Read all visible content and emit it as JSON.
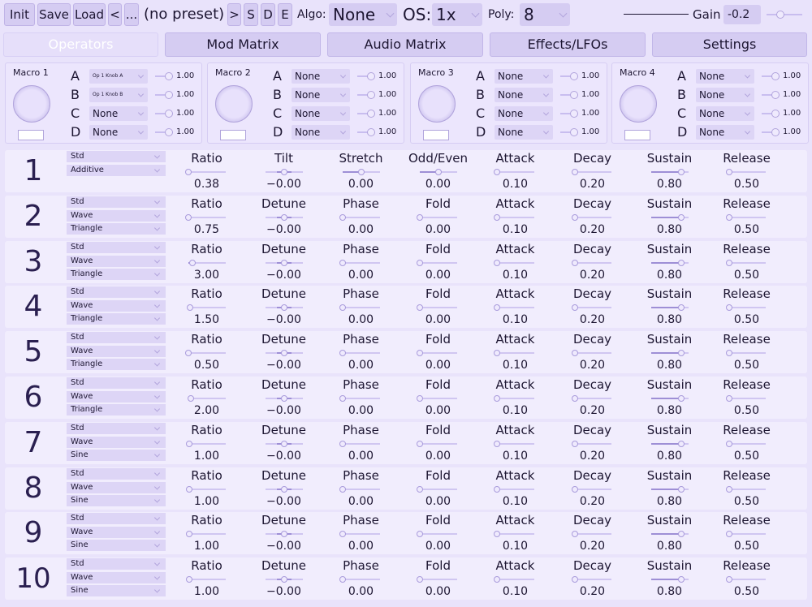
{
  "toolbar": {
    "init": "Init",
    "save": "Save",
    "load": "Load",
    "prev": "<",
    "browse": "...",
    "preset": "(no preset)",
    "next": ">",
    "s": "S",
    "d": "D",
    "e": "E",
    "algo_label": "Algo:",
    "algo_value": "None",
    "os_label": "OS:",
    "os_value": "1x",
    "poly_label": "Poly:",
    "poly_value": "8",
    "gain_label": "Gain",
    "gain_value": "-0.2"
  },
  "tabs": [
    {
      "label": "Operators",
      "active": true
    },
    {
      "label": "Mod Matrix"
    },
    {
      "label": "Audio Matrix"
    },
    {
      "label": "Effects/LFOs"
    },
    {
      "label": "Settings"
    }
  ],
  "macros": [
    {
      "title": "Macro 1",
      "rows": [
        {
          "letter": "A",
          "target": "Op 1 Knob A",
          "value": "1.00"
        },
        {
          "letter": "B",
          "target": "Op 1 Knob B",
          "value": "1.00"
        },
        {
          "letter": "C",
          "target": "None",
          "value": "1.00"
        },
        {
          "letter": "D",
          "target": "None",
          "value": "1.00"
        }
      ]
    },
    {
      "title": "Macro 2",
      "rows": [
        {
          "letter": "A",
          "target": "None",
          "value": "1.00"
        },
        {
          "letter": "B",
          "target": "None",
          "value": "1.00"
        },
        {
          "letter": "C",
          "target": "None",
          "value": "1.00"
        },
        {
          "letter": "D",
          "target": "None",
          "value": "1.00"
        }
      ]
    },
    {
      "title": "Macro 3",
      "rows": [
        {
          "letter": "A",
          "target": "None",
          "value": "1.00"
        },
        {
          "letter": "B",
          "target": "None",
          "value": "1.00"
        },
        {
          "letter": "C",
          "target": "None",
          "value": "1.00"
        },
        {
          "letter": "D",
          "target": "None",
          "value": "1.00"
        }
      ]
    },
    {
      "title": "Macro 4",
      "rows": [
        {
          "letter": "A",
          "target": "None",
          "value": "1.00"
        },
        {
          "letter": "B",
          "target": "None",
          "value": "1.00"
        },
        {
          "letter": "C",
          "target": "None",
          "value": "1.00"
        },
        {
          "letter": "D",
          "target": "None",
          "value": "1.00"
        }
      ]
    }
  ],
  "operators": [
    {
      "num": "1",
      "combos": [
        "Std",
        "Additive"
      ],
      "params": [
        {
          "label": "Ratio",
          "value": "0.38",
          "level": 0.0
        },
        {
          "label": "Tilt",
          "value": "−0.00",
          "level": 0.5
        },
        {
          "label": "Stretch",
          "value": "0.00",
          "level": 0.5
        },
        {
          "label": "Odd/Even",
          "value": "0.00",
          "level": 0.5
        },
        {
          "label": "Attack",
          "value": "0.10",
          "level": 0.0
        },
        {
          "label": "Decay",
          "value": "0.20",
          "level": 0.02
        },
        {
          "label": "Sustain",
          "value": "0.80",
          "level": 0.8
        },
        {
          "label": "Release",
          "value": "0.50",
          "level": 0.02
        }
      ]
    },
    {
      "num": "2",
      "combos": [
        "Std",
        "Wave",
        "Triangle"
      ],
      "params": [
        {
          "label": "Ratio",
          "value": "0.75",
          "level": 0.0
        },
        {
          "label": "Detune",
          "value": "−0.00",
          "level": 0.5
        },
        {
          "label": "Phase",
          "value": "0.00",
          "level": 0.0
        },
        {
          "label": "Fold",
          "value": "0.00",
          "level": 0.0
        },
        {
          "label": "Attack",
          "value": "0.10",
          "level": 0.0
        },
        {
          "label": "Decay",
          "value": "0.20",
          "level": 0.02
        },
        {
          "label": "Sustain",
          "value": "0.80",
          "level": 0.8
        },
        {
          "label": "Release",
          "value": "0.50",
          "level": 0.02
        }
      ]
    },
    {
      "num": "3",
      "combos": [
        "Std",
        "Wave",
        "Triangle"
      ],
      "params": [
        {
          "label": "Ratio",
          "value": "3.00",
          "level": 0.1
        },
        {
          "label": "Detune",
          "value": "−0.00",
          "level": 0.5
        },
        {
          "label": "Phase",
          "value": "0.00",
          "level": 0.0
        },
        {
          "label": "Fold",
          "value": "0.00",
          "level": 0.0
        },
        {
          "label": "Attack",
          "value": "0.10",
          "level": 0.0
        },
        {
          "label": "Decay",
          "value": "0.20",
          "level": 0.02
        },
        {
          "label": "Sustain",
          "value": "0.80",
          "level": 0.8
        },
        {
          "label": "Release",
          "value": "0.50",
          "level": 0.02
        }
      ]
    },
    {
      "num": "4",
      "combos": [
        "Std",
        "Wave",
        "Triangle"
      ],
      "params": [
        {
          "label": "Ratio",
          "value": "1.50",
          "level": 0.04
        },
        {
          "label": "Detune",
          "value": "−0.00",
          "level": 0.5
        },
        {
          "label": "Phase",
          "value": "0.00",
          "level": 0.0
        },
        {
          "label": "Fold",
          "value": "0.00",
          "level": 0.0
        },
        {
          "label": "Attack",
          "value": "0.10",
          "level": 0.0
        },
        {
          "label": "Decay",
          "value": "0.20",
          "level": 0.02
        },
        {
          "label": "Sustain",
          "value": "0.80",
          "level": 0.8
        },
        {
          "label": "Release",
          "value": "0.50",
          "level": 0.02
        }
      ]
    },
    {
      "num": "5",
      "combos": [
        "Std",
        "Wave",
        "Triangle"
      ],
      "params": [
        {
          "label": "Ratio",
          "value": "0.50",
          "level": 0.0
        },
        {
          "label": "Detune",
          "value": "−0.00",
          "level": 0.5
        },
        {
          "label": "Phase",
          "value": "0.00",
          "level": 0.0
        },
        {
          "label": "Fold",
          "value": "0.00",
          "level": 0.0
        },
        {
          "label": "Attack",
          "value": "0.10",
          "level": 0.0
        },
        {
          "label": "Decay",
          "value": "0.20",
          "level": 0.02
        },
        {
          "label": "Sustain",
          "value": "0.80",
          "level": 0.8
        },
        {
          "label": "Release",
          "value": "0.50",
          "level": 0.02
        }
      ]
    },
    {
      "num": "6",
      "combos": [
        "Std",
        "Wave",
        "Triangle"
      ],
      "params": [
        {
          "label": "Ratio",
          "value": "2.00",
          "level": 0.06
        },
        {
          "label": "Detune",
          "value": "−0.00",
          "level": 0.5
        },
        {
          "label": "Phase",
          "value": "0.00",
          "level": 0.0
        },
        {
          "label": "Fold",
          "value": "0.00",
          "level": 0.0
        },
        {
          "label": "Attack",
          "value": "0.10",
          "level": 0.0
        },
        {
          "label": "Decay",
          "value": "0.20",
          "level": 0.02
        },
        {
          "label": "Sustain",
          "value": "0.80",
          "level": 0.8
        },
        {
          "label": "Release",
          "value": "0.50",
          "level": 0.02
        }
      ]
    },
    {
      "num": "7",
      "combos": [
        "Std",
        "Wave",
        "Sine"
      ],
      "params": [
        {
          "label": "Ratio",
          "value": "1.00",
          "level": 0.02
        },
        {
          "label": "Detune",
          "value": "−0.00",
          "level": 0.5
        },
        {
          "label": "Phase",
          "value": "0.00",
          "level": 0.0
        },
        {
          "label": "Fold",
          "value": "0.00",
          "level": 0.0
        },
        {
          "label": "Attack",
          "value": "0.10",
          "level": 0.0
        },
        {
          "label": "Decay",
          "value": "0.20",
          "level": 0.02
        },
        {
          "label": "Sustain",
          "value": "0.80",
          "level": 0.8
        },
        {
          "label": "Release",
          "value": "0.50",
          "level": 0.02
        }
      ]
    },
    {
      "num": "8",
      "combos": [
        "Std",
        "Wave",
        "Sine"
      ],
      "params": [
        {
          "label": "Ratio",
          "value": "1.00",
          "level": 0.02
        },
        {
          "label": "Detune",
          "value": "−0.00",
          "level": 0.5
        },
        {
          "label": "Phase",
          "value": "0.00",
          "level": 0.0
        },
        {
          "label": "Fold",
          "value": "0.00",
          "level": 0.0
        },
        {
          "label": "Attack",
          "value": "0.10",
          "level": 0.0
        },
        {
          "label": "Decay",
          "value": "0.20",
          "level": 0.02
        },
        {
          "label": "Sustain",
          "value": "0.80",
          "level": 0.8
        },
        {
          "label": "Release",
          "value": "0.50",
          "level": 0.02
        }
      ]
    },
    {
      "num": "9",
      "combos": [
        "Std",
        "Wave",
        "Sine"
      ],
      "params": [
        {
          "label": "Ratio",
          "value": "1.00",
          "level": 0.02
        },
        {
          "label": "Detune",
          "value": "−0.00",
          "level": 0.5
        },
        {
          "label": "Phase",
          "value": "0.00",
          "level": 0.0
        },
        {
          "label": "Fold",
          "value": "0.00",
          "level": 0.0
        },
        {
          "label": "Attack",
          "value": "0.10",
          "level": 0.0
        },
        {
          "label": "Decay",
          "value": "0.20",
          "level": 0.02
        },
        {
          "label": "Sustain",
          "value": "0.80",
          "level": 0.8
        },
        {
          "label": "Release",
          "value": "0.50",
          "level": 0.02
        }
      ]
    },
    {
      "num": "10",
      "combos": [
        "Std",
        "Wave",
        "Sine"
      ],
      "params": [
        {
          "label": "Ratio",
          "value": "1.00",
          "level": 0.02
        },
        {
          "label": "Detune",
          "value": "−0.00",
          "level": 0.5
        },
        {
          "label": "Phase",
          "value": "0.00",
          "level": 0.0
        },
        {
          "label": "Fold",
          "value": "0.00",
          "level": 0.0
        },
        {
          "label": "Attack",
          "value": "0.10",
          "level": 0.0
        },
        {
          "label": "Decay",
          "value": "0.20",
          "level": 0.02
        },
        {
          "label": "Sustain",
          "value": "0.80",
          "level": 0.8
        },
        {
          "label": "Release",
          "value": "0.50",
          "level": 0.02
        }
      ]
    }
  ]
}
